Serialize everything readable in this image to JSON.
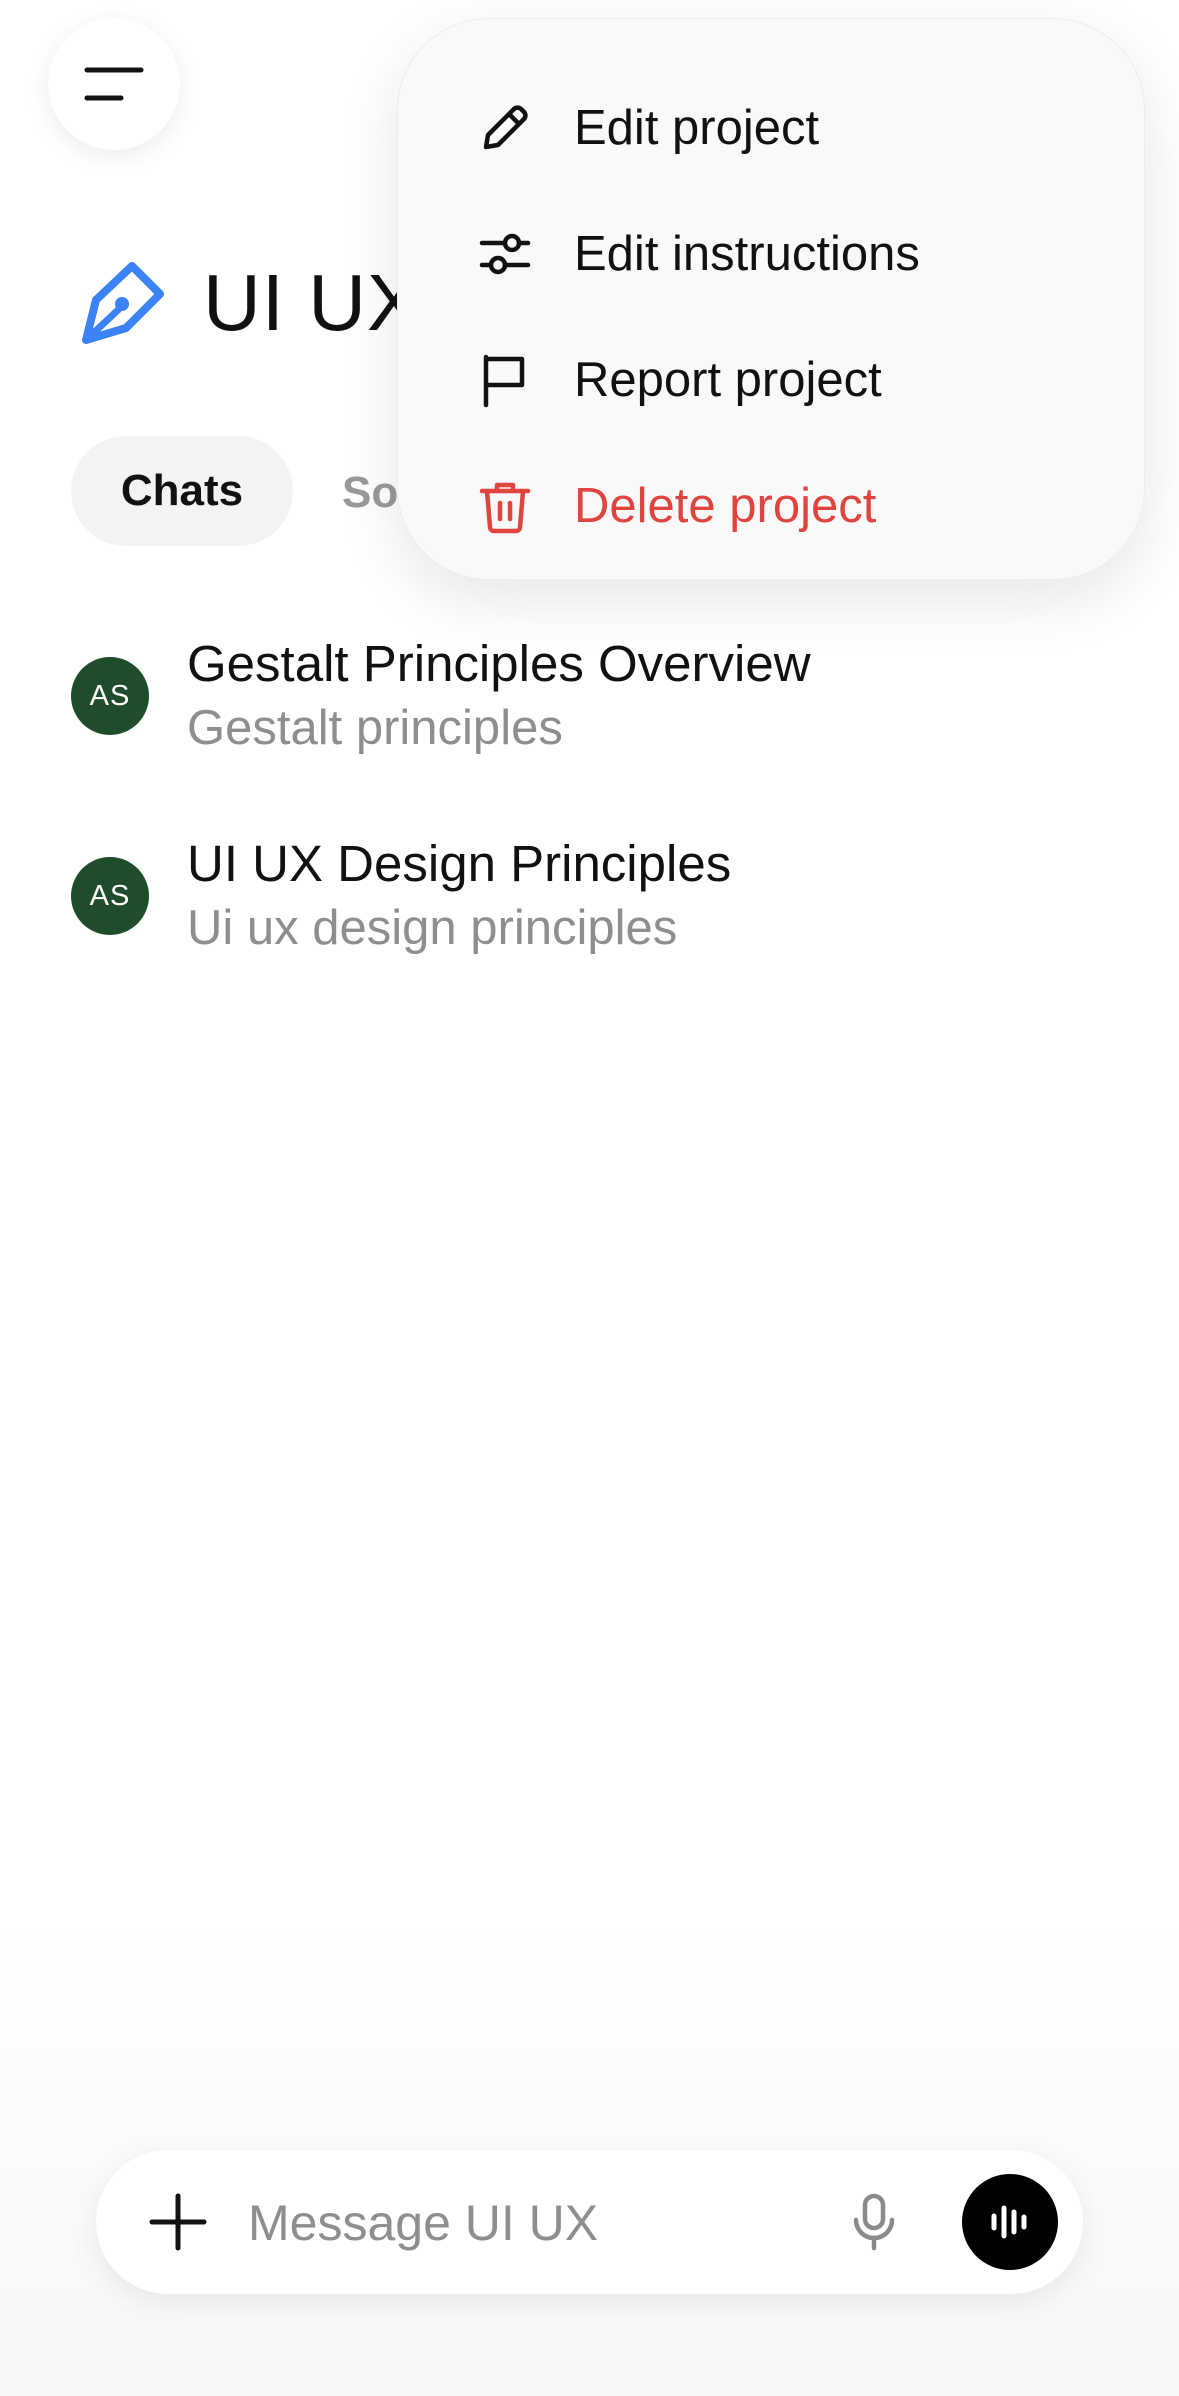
{
  "header": {
    "menu_icon": "hamburger-menu-icon",
    "project_icon": "pen-nib-icon",
    "project_title": "UI UX",
    "accent_color": "#3b82f6"
  },
  "tabs": [
    {
      "label": "Chats",
      "selected": true
    },
    {
      "label": "So",
      "selected": false
    }
  ],
  "chats": [
    {
      "avatar": "AS",
      "title": "Gestalt Principles Overview",
      "subtitle": "Gestalt principles"
    },
    {
      "avatar": "AS",
      "title": "UI UX Design Principles",
      "subtitle": "Ui ux design principles"
    }
  ],
  "dropdown": {
    "items": [
      {
        "label": "Edit project",
        "icon": "pencil-icon"
      },
      {
        "label": "Edit instructions",
        "icon": "sliders-icon"
      },
      {
        "label": "Report project",
        "icon": "flag-icon"
      },
      {
        "label": "Delete project",
        "icon": "trash-icon",
        "color": "#e0443e"
      }
    ]
  },
  "composer": {
    "placeholder": "Message UI UX",
    "plus_icon": "plus-icon",
    "mic_icon": "microphone-icon",
    "voice_icon": "voice-waveform-icon"
  }
}
